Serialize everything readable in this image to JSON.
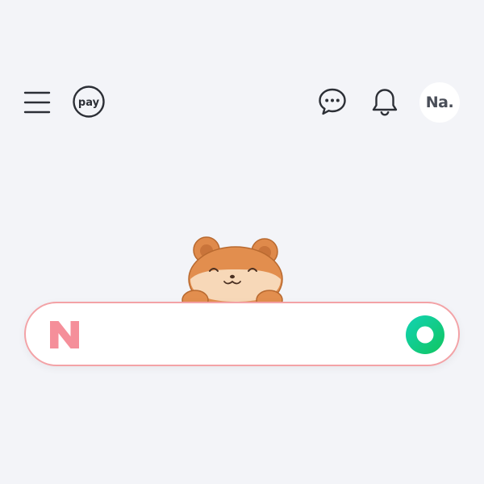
{
  "header": {
    "menu_icon": "hamburger-menu-icon",
    "pay_label": "pay",
    "chat_icon": "chat-bubble-icon",
    "bell_icon": "bell-icon",
    "avatar_label": "Na."
  },
  "mascot": {
    "icon": "bear-mascot"
  },
  "search": {
    "logo_letter": "N",
    "value": "",
    "placeholder": "",
    "submit_icon": "green-ring-search-icon"
  },
  "colors": {
    "background": "#f3f4f8",
    "search_border": "#f3a2a6",
    "logo_pink": "#f58f9a",
    "submit_gradient_start": "#12d3b4",
    "submit_gradient_end": "#11c55f"
  }
}
